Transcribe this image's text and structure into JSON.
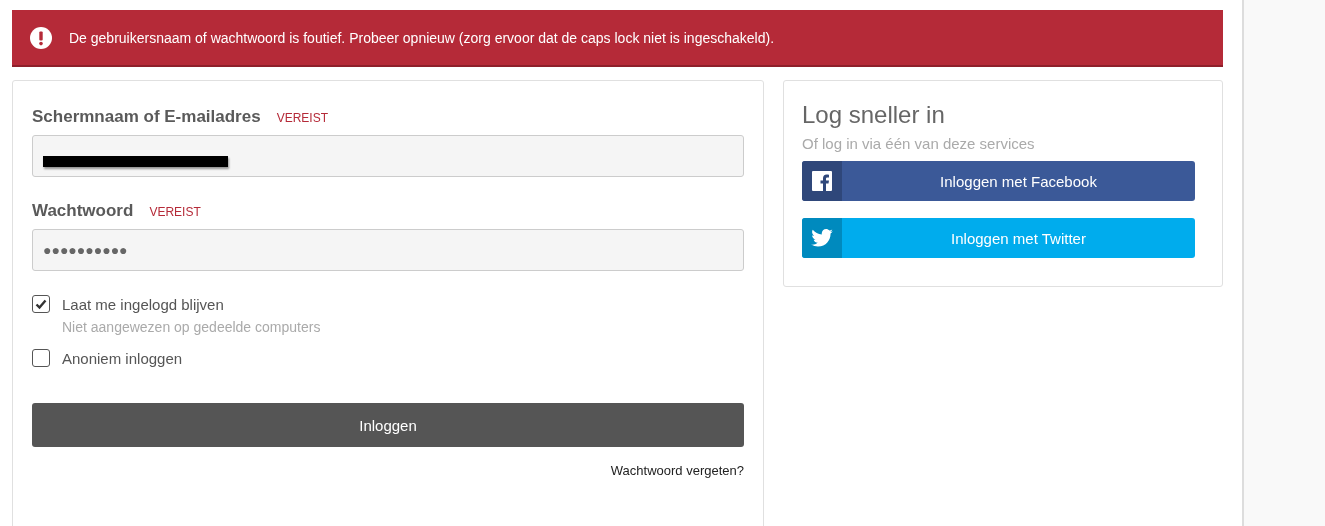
{
  "alert": {
    "message": "De gebruikersnaam of wachtwoord is foutief. Probeer opnieuw (zorg ervoor dat de caps lock niet is ingeschakeld)."
  },
  "login_form": {
    "fields": [
      {
        "label": "Schermnaam of E-mailadres",
        "tag": "VEREIST",
        "redacted": true
      },
      {
        "label": "Wachtwoord",
        "tag": "VEREIST",
        "value": "●●●●●●●●●●"
      }
    ],
    "options": [
      {
        "label": "Laat me ingelogd blijven",
        "hint": "Niet aangewezen op gedeelde computers",
        "checked": true
      },
      {
        "label": "Anoniem inloggen",
        "checked": false
      }
    ],
    "submit": "Inloggen",
    "forgot_link": "Wachtwoord vergeten?"
  },
  "social": {
    "title": "Log sneller in",
    "subtitle": "Of log in via één van deze services",
    "buttons": [
      {
        "label": "Inloggen met Facebook",
        "kind": "facebook",
        "color": "#3b5998"
      },
      {
        "label": "Inloggen met Twitter",
        "kind": "twitter",
        "color": "#00aced"
      }
    ]
  }
}
